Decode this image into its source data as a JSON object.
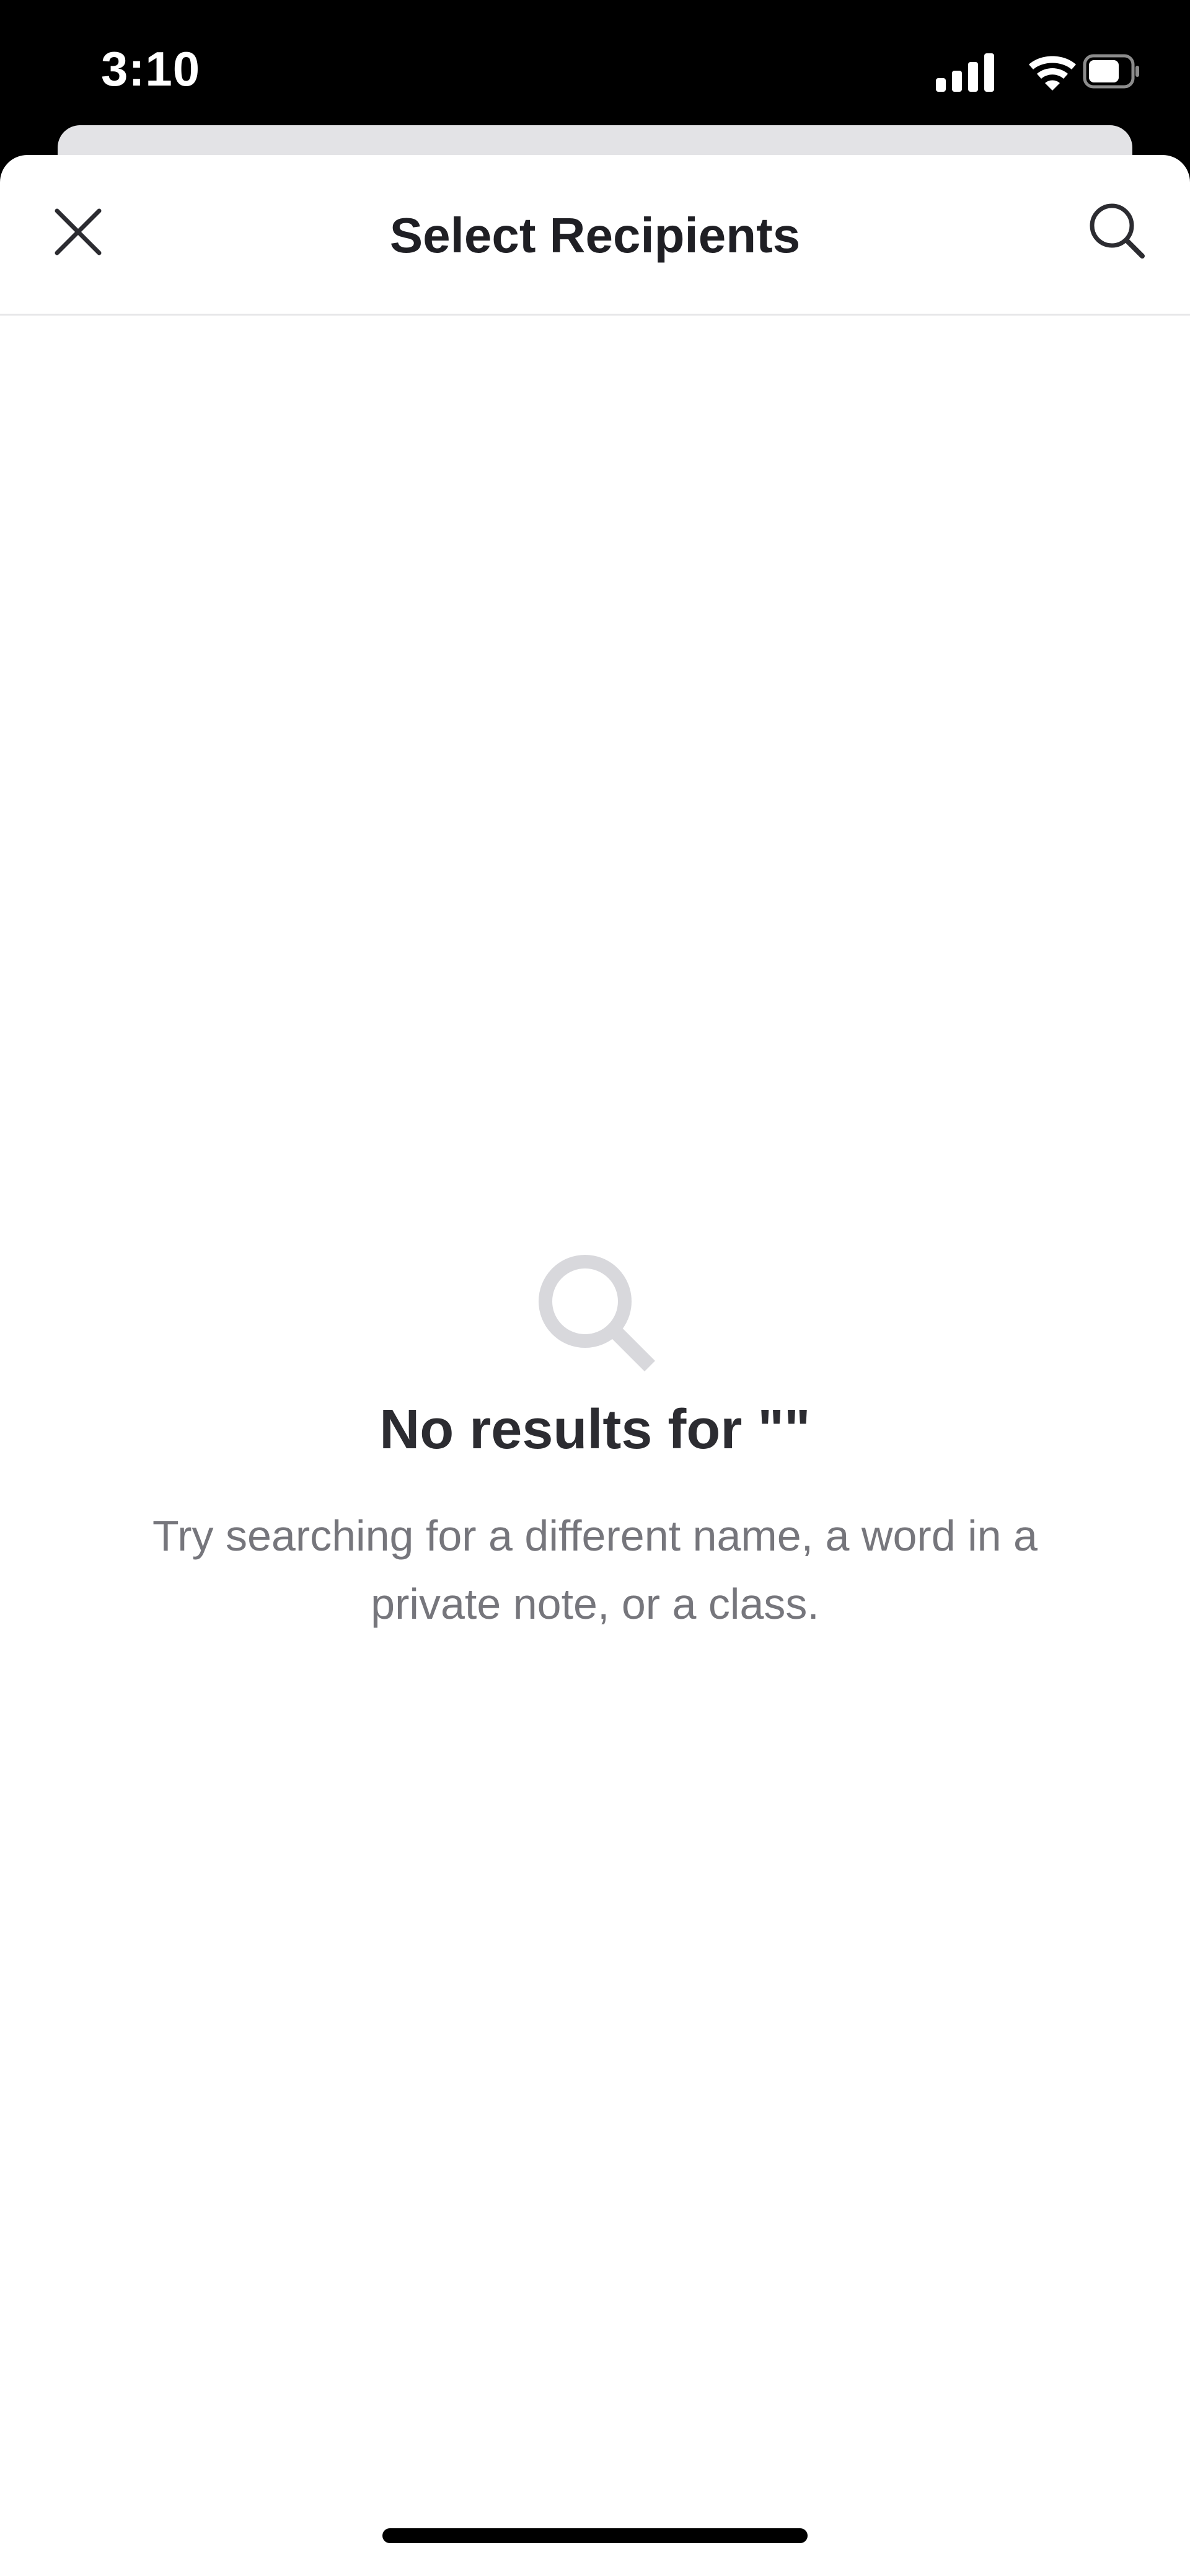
{
  "status_bar": {
    "time": "3:10",
    "icons": [
      "cellular-signal-icon",
      "wifi-icon",
      "battery-icon"
    ]
  },
  "nav": {
    "title": "Select Recipients",
    "close_icon": "close-icon",
    "search_icon": "search-icon"
  },
  "empty_state": {
    "icon": "search-icon",
    "title": "No results for \"\"",
    "message": "Try searching for a different name, a word in a private note, or a class."
  },
  "colors": {
    "text_primary": "#1f1f24",
    "text_secondary": "#76767c",
    "empty_icon": "#d8d8dc",
    "divider": "#e6e6e8"
  }
}
